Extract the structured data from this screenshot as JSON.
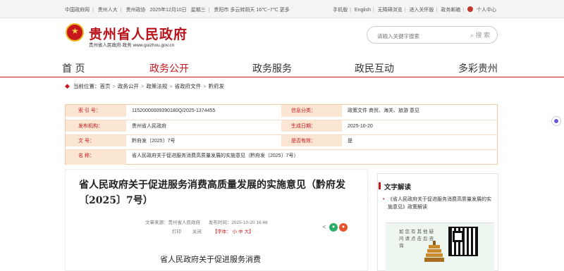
{
  "topbar": {
    "left": [
      "中国政府网",
      "贵州人大",
      "贵州政协",
      "2025年12月10日",
      "星期三",
      "贵阳市 多云转阴天 16℃~7℃ 更多"
    ],
    "right": [
      "手机版",
      "English",
      "无障碍浏览",
      "进入关怀版",
      "政务邮箱",
      "个人中心"
    ]
  },
  "header": {
    "site_title": "贵州省人民政府",
    "site_sub": "贵州省人民政府·政务  www.guizhou.gov.cn",
    "search_placeholder": "请输入关键字搜索",
    "search_button": "搜 索"
  },
  "nav": {
    "items": [
      "首  页",
      "政务公开",
      "政务服务",
      "政民互动",
      "多彩贵州"
    ],
    "active": 1
  },
  "breadcrumb": {
    "label": "当前位置：",
    "items": [
      "首页",
      "政务公开",
      "政策法规",
      "省政府文件",
      "黔府发"
    ]
  },
  "meta": {
    "rows": [
      {
        "label": "索 引 号：",
        "value": "11520000009390180Q/2025-1374455",
        "label2": "信息分类：",
        "value2": "政策文件    商贸、海关、旅游    意见"
      },
      {
        "label": "发布机构：",
        "value": "贵州省人民政府",
        "label2": "生成日期：",
        "value2": "2025-10-20"
      },
      {
        "label": "文     号：",
        "value": "黔府发〔2025〕7号",
        "label2": "是否有效：",
        "value2": "是"
      },
      {
        "label": "名     称：",
        "value": "省人民政府关于促进服务消费高质量发展的实施意见（黔府发〔2025〕7号）",
        "label2": "",
        "value2": ""
      }
    ]
  },
  "article": {
    "title": "省人民政府关于促进服务消费高质量发展的实施意见（黔府发〔2025〕7号）",
    "source": "文章来源：贵州省人民政府",
    "date": "发布时间：2025-10-20 16:48",
    "print": "打印",
    "close": "关闭",
    "font_label": "【字体：",
    "font_small": "小",
    "font_mid": "中",
    "font_big": "大】",
    "body_head": "省人民政府关于促进服务消费"
  },
  "side": {
    "title": "文字解读",
    "link": "《省人民政府关于促进服务消费高质量发展的实施意见》政策解读",
    "qr_text": "如您有其他疑问请点击后咨询"
  }
}
